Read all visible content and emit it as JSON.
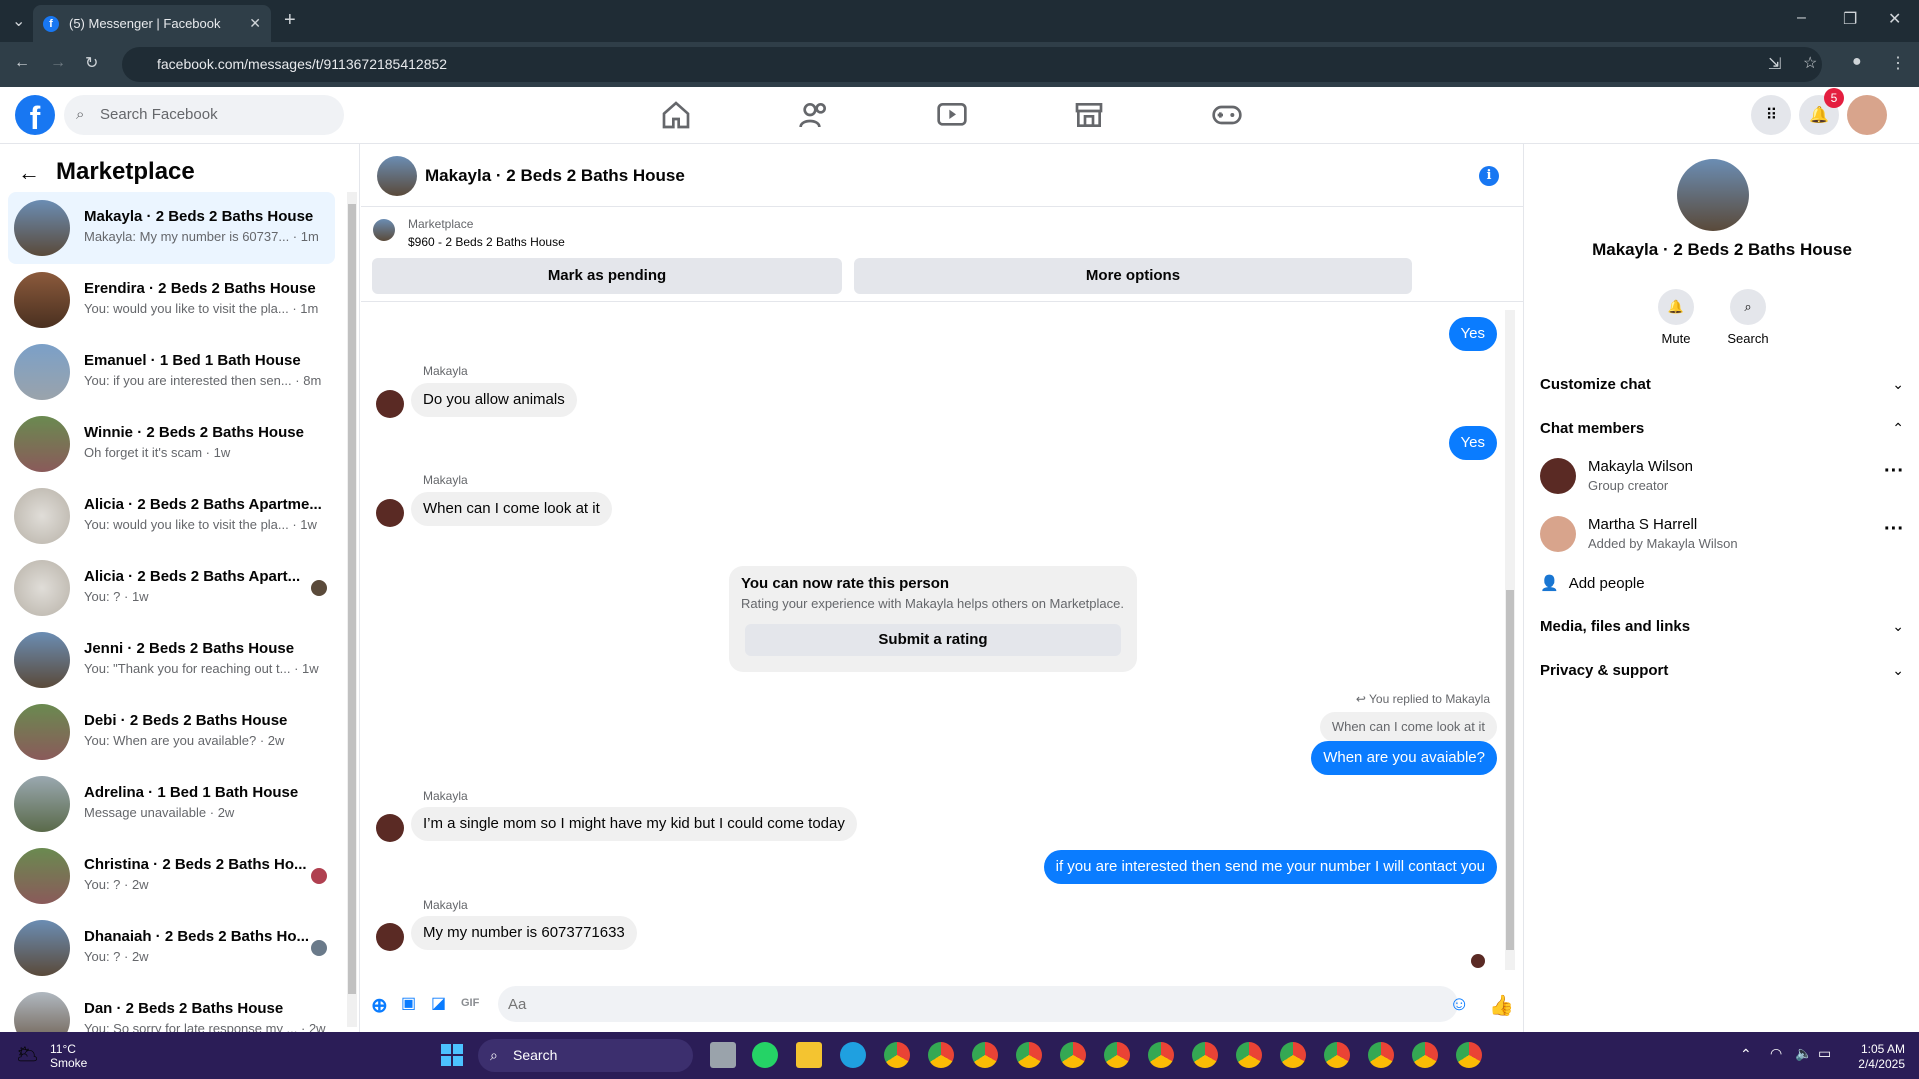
{
  "browser": {
    "tab_title": "(5) Messenger | Facebook",
    "url": "facebook.com/messages/t/9113672185412852"
  },
  "fb_header": {
    "search_placeholder": "Search Facebook",
    "notification_count": "5"
  },
  "sidebar": {
    "title": "Marketplace",
    "conversations": [
      {
        "title": "Makayla · 2 Beds 2 Baths House",
        "snippet": "Makayla: My my number is 60737... · 1m"
      },
      {
        "title": "Erendira · 2 Beds 2 Baths House",
        "snippet": "You: would you like to visit the pla... · 1m"
      },
      {
        "title": "Emanuel · 1 Bed 1 Bath House",
        "snippet": "You: if you are interested then sen... · 8m"
      },
      {
        "title": "Winnie · 2 Beds 2 Baths House",
        "snippet": "Oh forget it it's scam · 1w"
      },
      {
        "title": "Alicia · 2 Beds 2 Baths Apartme...",
        "snippet": "You: would you like to visit the pla... · 1w"
      },
      {
        "title": "Alicia · 2 Beds 2 Baths Apart...",
        "snippet": "You: ? · 1w"
      },
      {
        "title": "Jenni · 2 Beds 2 Baths House",
        "snippet": "You: \"Thank you for reaching out t... · 1w"
      },
      {
        "title": "Debi · 2 Beds 2 Baths House",
        "snippet": "You: When are you available? · 2w"
      },
      {
        "title": "Adrelina · 1 Bed 1 Bath House",
        "snippet": "Message unavailable · 2w"
      },
      {
        "title": "Christina · 2 Beds 2 Baths Ho...",
        "snippet": "You: ? · 2w"
      },
      {
        "title": "Dhanaiah · 2 Beds 2 Baths Ho...",
        "snippet": "You: ? · 2w"
      },
      {
        "title": "Dan · 2 Beds 2 Baths House",
        "snippet": "You: So sorry for late response my ... · 2w"
      }
    ]
  },
  "chat": {
    "title": "Makayla · 2 Beds 2 Baths House",
    "marketplace_label": "Marketplace",
    "listing": "$960 - 2 Beds 2 Baths House",
    "mark_pending": "Mark as pending",
    "more_options": "More options",
    "sender_name": "Makayla",
    "messages": {
      "yes1": "Yes",
      "animals": "Do you allow animals",
      "yes2": "Yes",
      "come_look": "When can I come look at it",
      "replied_label": "You replied to Makayla",
      "quoted": "When can I come look at it",
      "avaiable": "When are you avaiable?",
      "single_mom": "I’m a single mom so I might have my kid but I could come today",
      "interested": "if you are interested then send me your number I will contact you",
      "number": "My my number is 6073771633"
    },
    "rating": {
      "heading": "You can now rate this person",
      "text": "Rating your experience with Makayla helps others on Marketplace.",
      "button": "Submit a rating"
    },
    "composer_placeholder": "Aa"
  },
  "right_panel": {
    "title": "Makayla · 2 Beds 2 Baths House",
    "mute": "Mute",
    "search": "Search",
    "customize": "Customize chat",
    "members_heading": "Chat members",
    "members": [
      {
        "name": "Makayla Wilson",
        "role": "Group creator"
      },
      {
        "name": "Martha S Harrell",
        "role": "Added by Makayla Wilson"
      }
    ],
    "add_people": "Add people",
    "media": "Media, files and links",
    "privacy": "Privacy & support"
  },
  "taskbar": {
    "temperature": "11°C",
    "weather": "Smoke",
    "search": "Search",
    "time": "1:05 AM",
    "date": "2/4/2025"
  },
  "colors": {
    "accent": "#0a7cff",
    "brand": "#1877f2",
    "taskbar": "#2b1d57"
  }
}
